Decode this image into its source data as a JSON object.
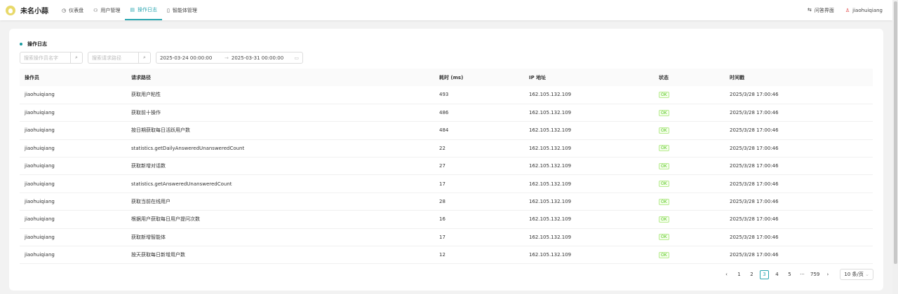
{
  "nav": {
    "brand": "未名小蒜",
    "items": [
      {
        "label": "仪表盘",
        "icon": "dashboard-icon"
      },
      {
        "label": "用户管理",
        "icon": "users-icon"
      },
      {
        "label": "操作日志",
        "icon": "file-icon",
        "active": true
      },
      {
        "label": "智能体管理",
        "icon": "doc-icon"
      }
    ],
    "qa": "问答界面",
    "user": "jiaohuiqiang"
  },
  "card": {
    "title": "操作日志",
    "search_operator_placeholder": "搜索操作员名字",
    "search_path_placeholder": "搜索请求路径",
    "date_start": "2025-03-24 00:00:00",
    "date_sep": "→",
    "date_end": "2025-03-31 00:00:00"
  },
  "table": {
    "headers": [
      "操作员",
      "请求路径",
      "耗时 (ms)",
      "IP 地址",
      "状态",
      "时间戳"
    ],
    "rows": [
      [
        "jiaohuiqiang",
        "获取用户粘性",
        "493",
        "162.105.132.109",
        "OK",
        "2025/3/28 17:00:46"
      ],
      [
        "jiaohuiqiang",
        "获取前十操作",
        "486",
        "162.105.132.109",
        "OK",
        "2025/3/28 17:00:46"
      ],
      [
        "jiaohuiqiang",
        "按日期获取每日活跃用户数",
        "484",
        "162.105.132.109",
        "OK",
        "2025/3/28 17:00:46"
      ],
      [
        "jiaohuiqiang",
        "statistics.getDailyAnsweredUnansweredCount",
        "22",
        "162.105.132.109",
        "OK",
        "2025/3/28 17:00:46"
      ],
      [
        "jiaohuiqiang",
        "获取新增对话数",
        "27",
        "162.105.132.109",
        "OK",
        "2025/3/28 17:00:46"
      ],
      [
        "jiaohuiqiang",
        "statistics.getAnsweredUnansweredCount",
        "17",
        "162.105.132.109",
        "OK",
        "2025/3/28 17:00:46"
      ],
      [
        "jiaohuiqiang",
        "获取当前在线用户",
        "28",
        "162.105.132.109",
        "OK",
        "2025/3/28 17:00:46"
      ],
      [
        "jiaohuiqiang",
        "根据用户获取每日用户提问次数",
        "16",
        "162.105.132.109",
        "OK",
        "2025/3/28 17:00:46"
      ],
      [
        "jiaohuiqiang",
        "获取新增智能体",
        "17",
        "162.105.132.109",
        "OK",
        "2025/3/28 17:00:46"
      ],
      [
        "jiaohuiqiang",
        "按天获取每日新增用户数",
        "12",
        "162.105.132.109",
        "OK",
        "2025/3/28 17:00:46"
      ]
    ]
  },
  "pager": {
    "prev": "‹",
    "pages": [
      "1",
      "2",
      "3",
      "4",
      "5",
      "···",
      "759"
    ],
    "current": "3",
    "next": "›",
    "page_size": "10 条/页"
  }
}
